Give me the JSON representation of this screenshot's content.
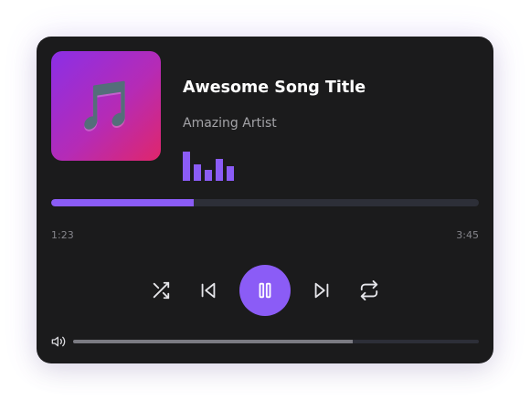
{
  "track": {
    "title": "Awesome Song Title",
    "artist": "Amazing Artist",
    "art_icon": "music-note-icon",
    "art_glyph": "🎵"
  },
  "visualizer": {
    "bars": [
      0.8,
      0.45,
      0.3,
      0.6,
      0.4
    ]
  },
  "playback": {
    "current_time": "1:23",
    "total_time": "3:45",
    "progress": 0.333,
    "state": "playing"
  },
  "controls": {
    "shuffle_icon": "shuffle-icon",
    "previous_icon": "skip-back-icon",
    "pause_icon": "pause-icon",
    "next_icon": "skip-forward-icon",
    "repeat_icon": "repeat-icon"
  },
  "volume": {
    "icon": "speaker-icon",
    "level": 0.69
  },
  "colors": {
    "accent": "#8b5cf6",
    "card": "#1b1b1c",
    "track": "#2d2f38",
    "text_primary": "#ffffff",
    "text_secondary": "#a3a3a7",
    "art_gradient_start": "#8b2fe6",
    "art_gradient_end": "#e0266b"
  }
}
